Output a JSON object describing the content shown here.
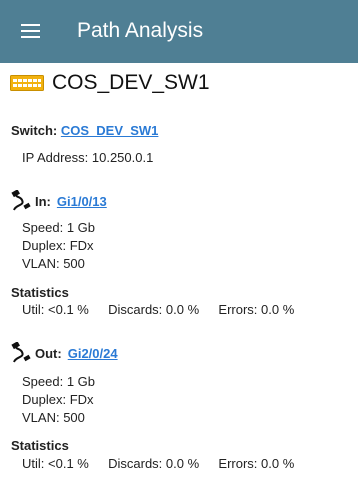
{
  "appbar": {
    "title": "Path Analysis",
    "menu_icon": "menu-icon"
  },
  "device": {
    "icon": "switch-device-icon",
    "name": "COS_DEV_SW1",
    "icon_color": "#f2b20f"
  },
  "switch": {
    "label": "Switch:",
    "link": "COS_DEV_SW1"
  },
  "ip": {
    "label": "IP Address:",
    "value": "10.250.0.1"
  },
  "in_port": {
    "icon": "port-connector-icon",
    "label": "In:",
    "link": "Gi1/0/13",
    "speed_label": "Speed:",
    "speed": "1 Gb",
    "duplex_label": "Duplex:",
    "duplex": "FDx",
    "vlan_label": "VLAN:",
    "vlan": "500",
    "stats_title": "Statistics",
    "util_label": "Util:",
    "util": "<0.1 %",
    "discards_label": "Discards:",
    "discards": "0.0 %",
    "errors_label": "Errors:",
    "errors": "0.0 %"
  },
  "out_port": {
    "icon": "port-connector-icon",
    "label": "Out:",
    "link": "Gi2/0/24",
    "speed_label": "Speed:",
    "speed": "1 Gb",
    "duplex_label": "Duplex:",
    "duplex": "FDx",
    "vlan_label": "VLAN:",
    "vlan": "500",
    "stats_title": "Statistics",
    "util_label": "Util:",
    "util": "<0.1 %",
    "discards_label": "Discards:",
    "discards": "0.0 %",
    "errors_label": "Errors:",
    "errors": "0.0 %"
  },
  "colors": {
    "appbar": "#4f7f94",
    "link": "#2a7ad5"
  }
}
